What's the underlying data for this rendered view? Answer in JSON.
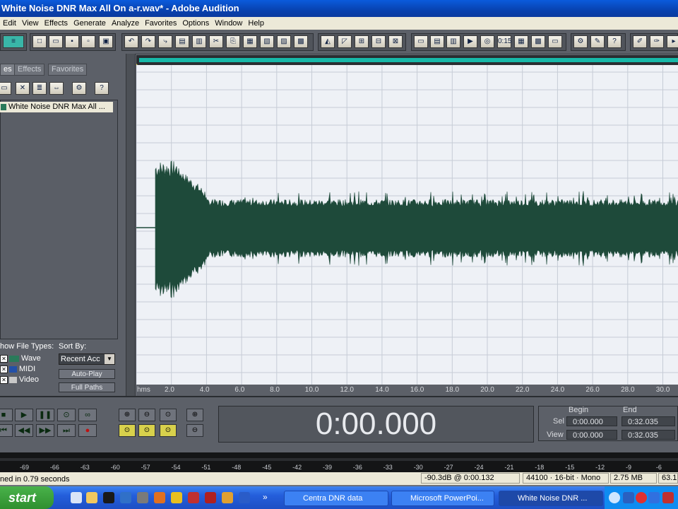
{
  "window": {
    "title": "White Noise DNR Max All On a-r.wav* - Adobe Audition"
  },
  "menu": [
    "Edit",
    "View",
    "Effects",
    "Generate",
    "Analyze",
    "Favorites",
    "Options",
    "Window",
    "Help"
  ],
  "left_panel": {
    "tabs": [
      "es",
      "Effects",
      "Favorites"
    ],
    "files": [
      "White Noise DNR Max All ..."
    ],
    "show_file_types_label": "how File Types:",
    "sort_by_label": "Sort By:",
    "sort_by_value": "Recent Acc",
    "file_types": [
      "Wave",
      "MIDI",
      "Video"
    ],
    "auto_play_label": "Auto-Play",
    "full_paths_label": "Full Paths"
  },
  "ruler": {
    "unit": "hms",
    "ticks": [
      "2.0",
      "4.0",
      "6.0",
      "8.0",
      "10.0",
      "12.0",
      "14.0",
      "16.0",
      "18.0",
      "20.0",
      "22.0",
      "24.0",
      "26.0",
      "28.0",
      "30.0"
    ]
  },
  "time_display": "0:00.000",
  "selection": {
    "begin_label": "Begin",
    "end_label": "End",
    "sel_label": "Sel",
    "view_label": "View",
    "sel_begin": "0:00.000",
    "sel_end": "0:32.035",
    "view_begin": "0:00.000",
    "view_end": "0:32.035"
  },
  "level_meter": {
    "ticks": [
      "-69",
      "-66",
      "-63",
      "-60",
      "-57",
      "-54",
      "-51",
      "-48",
      "-45",
      "-42",
      "-39",
      "-36",
      "-33",
      "-30",
      "-27",
      "-24",
      "-21",
      "-18",
      "-15",
      "-12",
      "-9",
      "-6"
    ]
  },
  "status": {
    "message": "ned in 0.79 seconds",
    "level": "-90.3dB @  0:00.132",
    "format": "44100 · 16-bit · Mono",
    "size": "2.75 MB",
    "free": "63.1"
  },
  "taskbar": {
    "start": "start",
    "tasks": [
      {
        "label": "Centra DNR data",
        "active": false
      },
      {
        "label": "Microsoft PowerPoi...",
        "active": false
      },
      {
        "label": "White Noise DNR ...",
        "active": true
      }
    ]
  },
  "colors": {
    "waveform": "#1e4a3a",
    "title_bar": "#0a5bdc",
    "taskbar": "#245edb",
    "start": "#3c9d3c"
  }
}
